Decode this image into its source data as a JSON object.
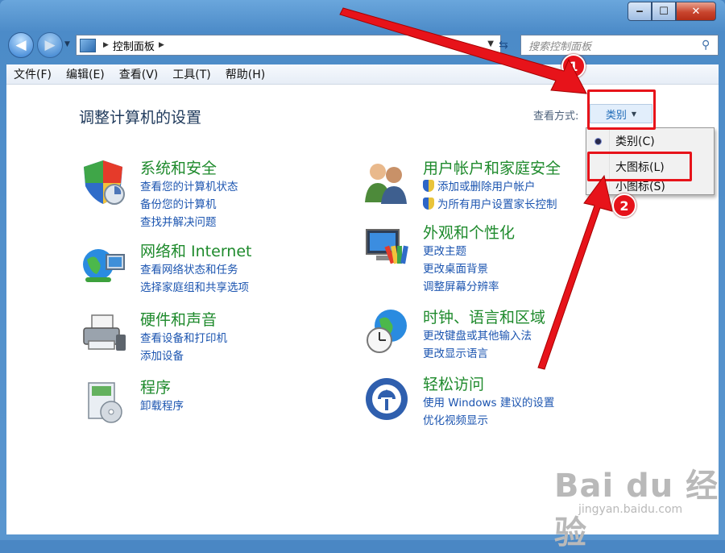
{
  "window": {
    "min": "‒",
    "max": "☐",
    "close": "✕"
  },
  "nav": {
    "back": "◀",
    "forward": "▶",
    "crumb_separator": "▶",
    "address": "控制面板",
    "search_placeholder": "搜索控制面板"
  },
  "menu": [
    "文件(F)",
    "编辑(E)",
    "查看(V)",
    "工具(T)",
    "帮助(H)"
  ],
  "page_title": "调整计算机的设置",
  "view": {
    "label": "查看方式:",
    "value": "类别"
  },
  "dropdown": [
    "类别(C)",
    "大图标(L)",
    "小图标(S)"
  ],
  "categories": [
    {
      "title": "系统和安全",
      "links": [
        "查看您的计算机状态",
        "备份您的计算机",
        "查找并解决问题"
      ]
    },
    {
      "title": "网络和 Internet",
      "links": [
        "查看网络状态和任务",
        "选择家庭组和共享选项"
      ]
    },
    {
      "title": "硬件和声音",
      "links": [
        "查看设备和打印机",
        "添加设备"
      ]
    },
    {
      "title": "程序",
      "links": [
        "卸载程序"
      ]
    },
    {
      "title": "用户帐户和家庭安全",
      "links": [
        "添加或删除用户帐户",
        "为所有用户设置家长控制"
      ]
    },
    {
      "title": "外观和个性化",
      "links": [
        "更改主题",
        "更改桌面背景",
        "调整屏幕分辨率"
      ]
    },
    {
      "title": "时钟、语言和区域",
      "links": [
        "更改键盘或其他输入法",
        "更改显示语言"
      ]
    },
    {
      "title": "轻松访问",
      "links": [
        "使用 Windows 建议的设置",
        "优化视频显示"
      ]
    }
  ],
  "annotations": {
    "badge1": "1",
    "badge2": "2"
  },
  "watermark": {
    "logo": "Bai du 经验",
    "url": "jingyan.baidu.com"
  },
  "colors": {
    "category_title": "#1e8a2c",
    "link": "#1c55b0",
    "annotation": "#e7131a"
  }
}
